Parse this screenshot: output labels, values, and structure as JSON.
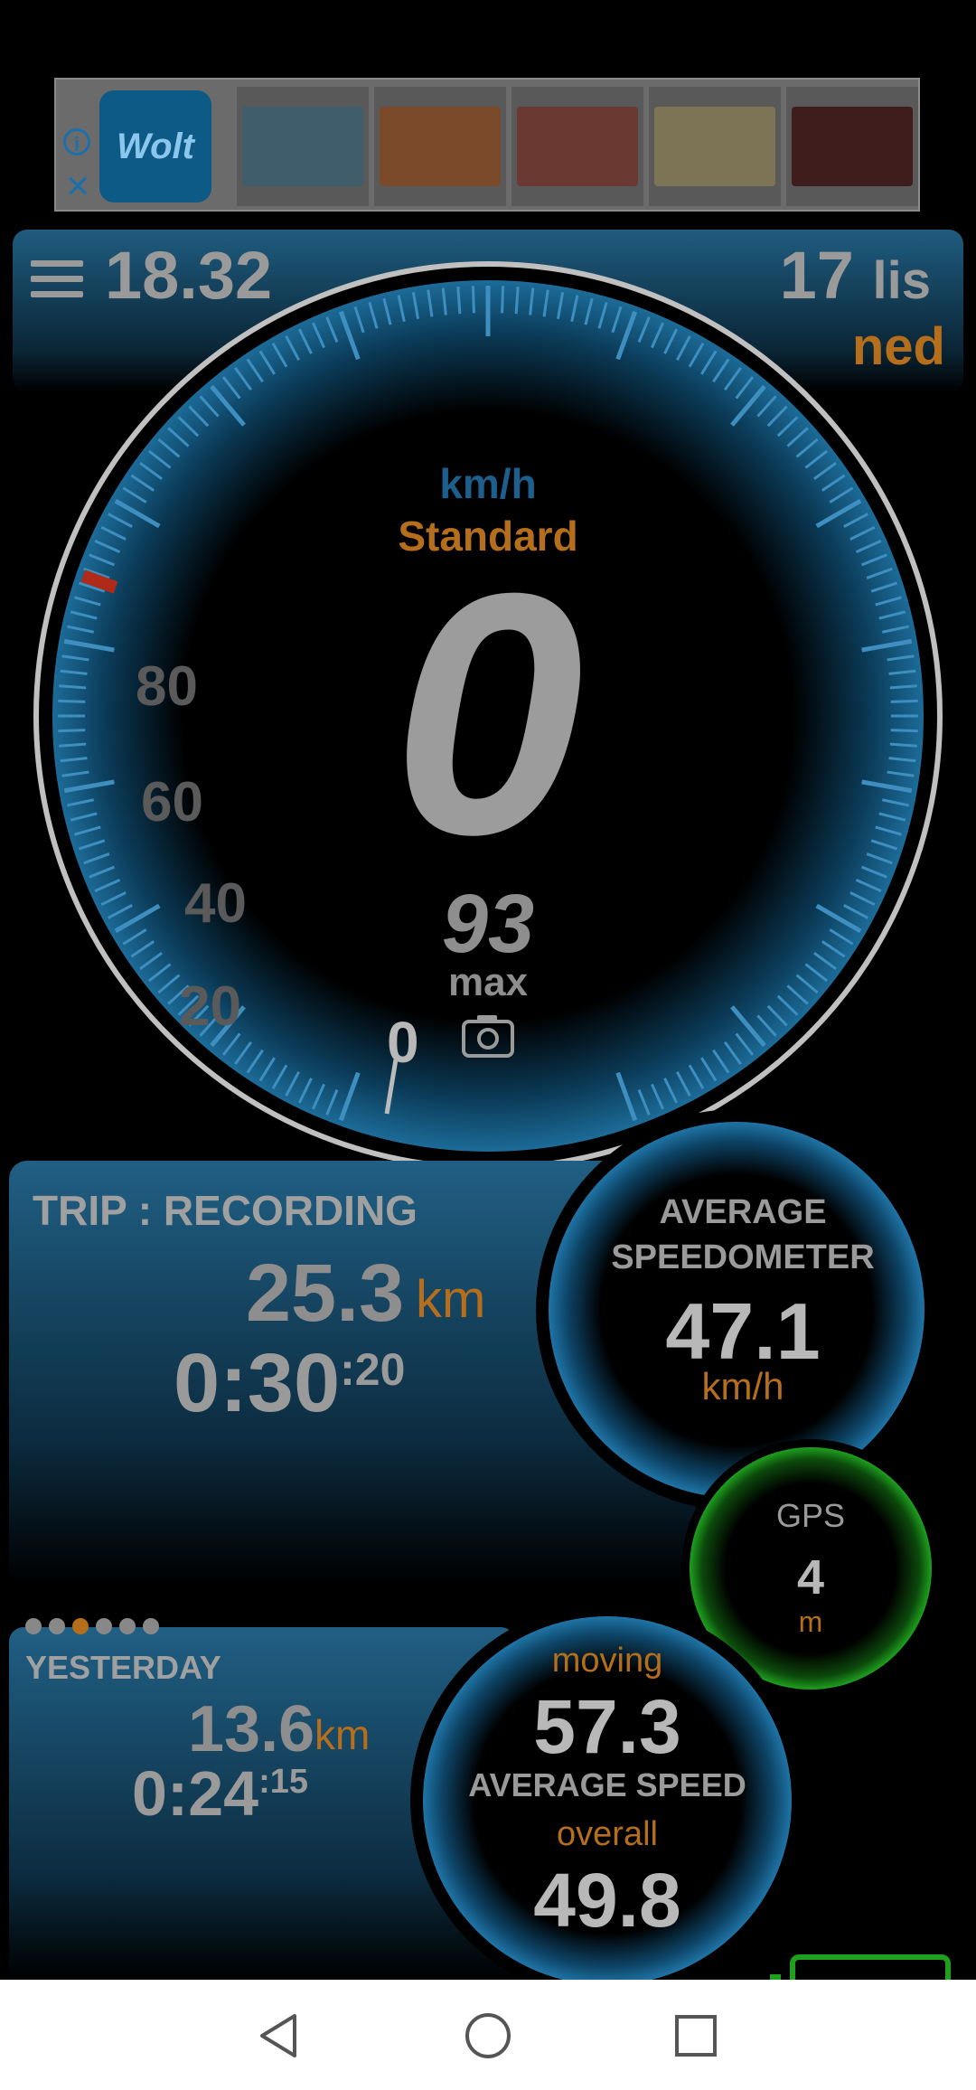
{
  "ad": {
    "brand": "Wolt",
    "info_icon": "info-icon",
    "close_icon": "close-icon",
    "thumbnails": [
      {
        "name": "thumb-food-platter",
        "color": "#3f5d6b"
      },
      {
        "name": "thumb-fruits",
        "color": "#7a4a2a"
      },
      {
        "name": "thumb-pizza",
        "color": "#6a3a32"
      },
      {
        "name": "thumb-pasta",
        "color": "#7d7456"
      },
      {
        "name": "thumb-cake",
        "color": "#3f1d1d"
      }
    ]
  },
  "header": {
    "time": "18.32",
    "day": "17",
    "month": "lis",
    "weekday": "ned"
  },
  "speedometer": {
    "unit": "km/h",
    "mode": "Standard",
    "speed": "0",
    "max": "93",
    "max_label": "max",
    "odometer": "0",
    "scale": [
      "20",
      "40",
      "60",
      "80"
    ]
  },
  "trip": {
    "title": "TRIP : RECORDING",
    "distance": "25.3",
    "distance_unit": "km",
    "time_main": "0:30",
    "time_sec": ":20"
  },
  "average": {
    "title_line1": "AVERAGE",
    "title_line2": "SPEEDOMETER",
    "value": "47.1",
    "unit": "km/h"
  },
  "gps": {
    "title": "GPS",
    "value": "4",
    "unit": "m"
  },
  "yesterday": {
    "title": "YESTERDAY",
    "distance": "13.6",
    "distance_unit": "km",
    "time_main": "0:24",
    "time_sec": ":15",
    "page_dots": 6,
    "active_dot": 2
  },
  "moving": {
    "label": "moving",
    "value": "57.3",
    "title": "AVERAGE SPEED",
    "overall_label": "overall",
    "overall_value": "49.8"
  },
  "colors": {
    "accent_orange": "#b46e1c",
    "accent_blue": "#1c5f8c",
    "gps_green": "#1ea01e"
  }
}
